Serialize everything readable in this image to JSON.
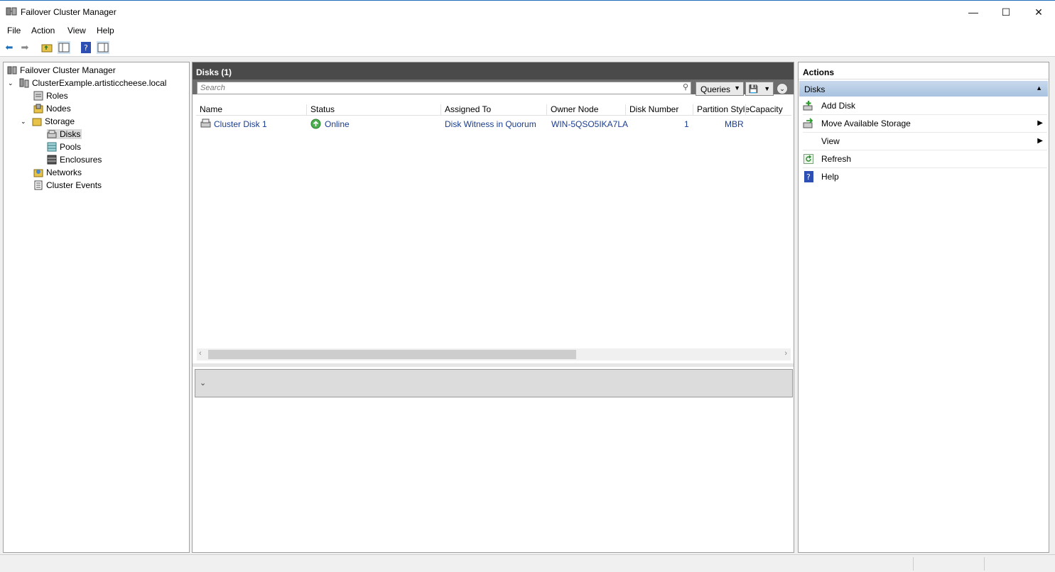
{
  "window": {
    "title": "Failover Cluster Manager",
    "minimize": "—",
    "maximize": "☐",
    "close": "✕"
  },
  "menu": [
    "File",
    "Action",
    "View",
    "Help"
  ],
  "tree": {
    "root": "Failover Cluster Manager",
    "cluster": "ClusterExample.artisticcheese.local",
    "roles": "Roles",
    "nodes": "Nodes",
    "storage": "Storage",
    "disks": "Disks",
    "pools": "Pools",
    "enclosures": "Enclosures",
    "networks": "Networks",
    "events": "Cluster Events"
  },
  "center": {
    "title": "Disks (1)",
    "search_placeholder": "Search",
    "queries_label": "Queries",
    "columns": [
      "Name",
      "Status",
      "Assigned To",
      "Owner Node",
      "Disk Number",
      "Partition Style",
      "Capacity"
    ],
    "rows": [
      {
        "name": "Cluster Disk 1",
        "status": "Online",
        "assigned": "Disk Witness in Quorum",
        "owner": "WIN-5QSO5IKA7LA",
        "number": "1",
        "partition": "MBR",
        "capacity": ""
      }
    ]
  },
  "actions": {
    "title": "Actions",
    "section": "Disks",
    "items": [
      "Add Disk",
      "Move Available Storage",
      "View",
      "Refresh",
      "Help"
    ]
  },
  "colors": {
    "accent": "#1e6fb8",
    "header_dark": "#4a4a4a",
    "link": "#1a3d8f",
    "section_blue": "#b7cde6"
  }
}
